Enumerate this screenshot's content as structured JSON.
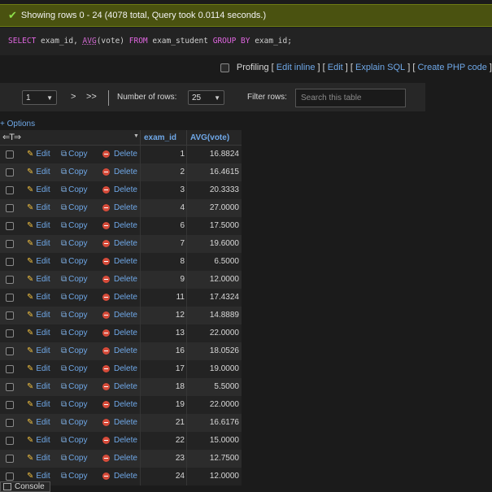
{
  "message": {
    "icon": "check-icon",
    "text": "Showing rows 0 - 24 (4078 total, Query took 0.0114 seconds.)"
  },
  "sql": {
    "kw_select": "SELECT",
    "part1": " exam_id, ",
    "fn_avg": "AVG",
    "part2": "(vote) ",
    "kw_from": "FROM",
    "part3": " exam_student ",
    "kw_group": "GROUP BY",
    "part4": " exam_id;"
  },
  "sql_tools": {
    "profiling": "Profiling",
    "edit_inline": "Edit inline",
    "edit": "Edit",
    "explain": "Explain SQL",
    "create_php": "Create PHP code"
  },
  "nav": {
    "page_value": "1",
    "next": ">",
    "last": ">>",
    "rows_label": "Number of rows:",
    "rows_value": "25",
    "filter_label": "Filter rows:",
    "filter_placeholder": "Search this table"
  },
  "options_label": "+ Options",
  "columns": {
    "exam_id": "exam_id",
    "avg": "AVG(vote)"
  },
  "actions": {
    "edit": "Edit",
    "copy": "Copy",
    "delete": "Delete"
  },
  "rows": [
    {
      "exam_id": "1",
      "avg": "16.8824"
    },
    {
      "exam_id": "2",
      "avg": "16.4615"
    },
    {
      "exam_id": "3",
      "avg": "20.3333"
    },
    {
      "exam_id": "4",
      "avg": "27.0000"
    },
    {
      "exam_id": "6",
      "avg": "17.5000"
    },
    {
      "exam_id": "7",
      "avg": "19.6000"
    },
    {
      "exam_id": "8",
      "avg": "6.5000"
    },
    {
      "exam_id": "9",
      "avg": "12.0000"
    },
    {
      "exam_id": "11",
      "avg": "17.4324"
    },
    {
      "exam_id": "12",
      "avg": "14.8889"
    },
    {
      "exam_id": "13",
      "avg": "22.0000"
    },
    {
      "exam_id": "16",
      "avg": "18.0526"
    },
    {
      "exam_id": "17",
      "avg": "19.0000"
    },
    {
      "exam_id": "18",
      "avg": "5.5000"
    },
    {
      "exam_id": "19",
      "avg": "22.0000"
    },
    {
      "exam_id": "21",
      "avg": "16.6176"
    },
    {
      "exam_id": "22",
      "avg": "15.0000"
    },
    {
      "exam_id": "23",
      "avg": "12.7500"
    },
    {
      "exam_id": "24",
      "avg": "12.0000"
    }
  ],
  "console_label": "Console"
}
